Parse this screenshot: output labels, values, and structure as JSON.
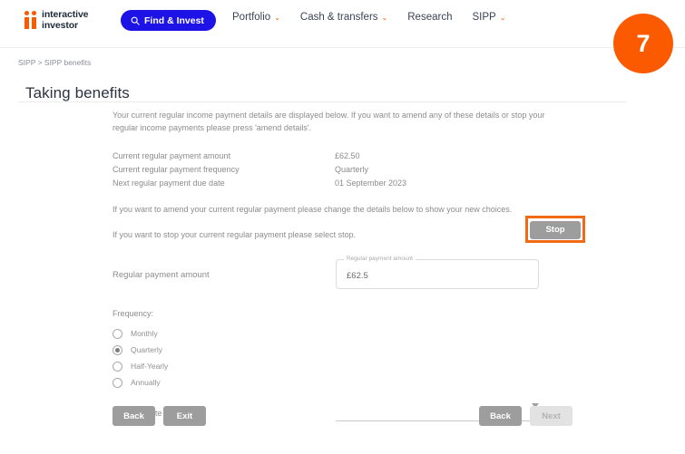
{
  "header": {
    "logo": {
      "line1": "interactive",
      "line2": "investor",
      "icon": "ii-logo-icon",
      "color": "#fb5a00"
    },
    "search_button": {
      "label": "Find & Invest",
      "icon": "search-icon",
      "color": "#1d13e6"
    },
    "nav": [
      {
        "label": "Portfolio",
        "caret": "⌄",
        "has_dropdown": true
      },
      {
        "label": "Cash & transfers",
        "caret": "⌄",
        "has_dropdown": true
      },
      {
        "label": "Research",
        "caret": "",
        "has_dropdown": false
      },
      {
        "label": "SIPP",
        "caret": "⌄",
        "has_dropdown": true
      }
    ],
    "badge": {
      "value": "7",
      "color": "#fb5a00"
    }
  },
  "page": {
    "breadcrumb": "SIPP > SIPP benefits",
    "title": "Taking benefits"
  },
  "main": {
    "intro": "Your current regular income payment details are displayed below. If you want to amend any of these details or stop your regular income payments please press 'amend details'.",
    "details": [
      {
        "label": "Current regular payment amount",
        "value": "£62.50"
      },
      {
        "label": "Current regular payment frequency",
        "value": "Quarterly"
      },
      {
        "label": "Next regular payment due date",
        "value": "01 September 2023"
      }
    ],
    "note_amend": "If you want to amend your current regular payment please change the details below to show your new choices.",
    "note_stop": "If you want to stop your current regular payment please select stop.",
    "stop_button": {
      "label": "Stop",
      "highlight_color": "#f26a16"
    },
    "amount_field": {
      "label": "Regular payment amount",
      "floating_label": "Regular payment amount",
      "value": "£62.5"
    },
    "frequency": {
      "label": "Frequency:",
      "options": [
        {
          "label": "Monthly",
          "selected": false
        },
        {
          "label": "Quarterly",
          "selected": true
        },
        {
          "label": "Half-Yearly",
          "selected": false
        },
        {
          "label": "Annually",
          "selected": false
        }
      ]
    },
    "effective_date": {
      "label": "Effective date of change:",
      "value": "",
      "caret": "chevron-down-icon"
    }
  },
  "footer": {
    "left": [
      {
        "label": "Back",
        "disabled": false
      },
      {
        "label": "Exit",
        "disabled": false
      }
    ],
    "right": [
      {
        "label": "Back",
        "disabled": false
      },
      {
        "label": "Next",
        "disabled": true
      }
    ]
  }
}
